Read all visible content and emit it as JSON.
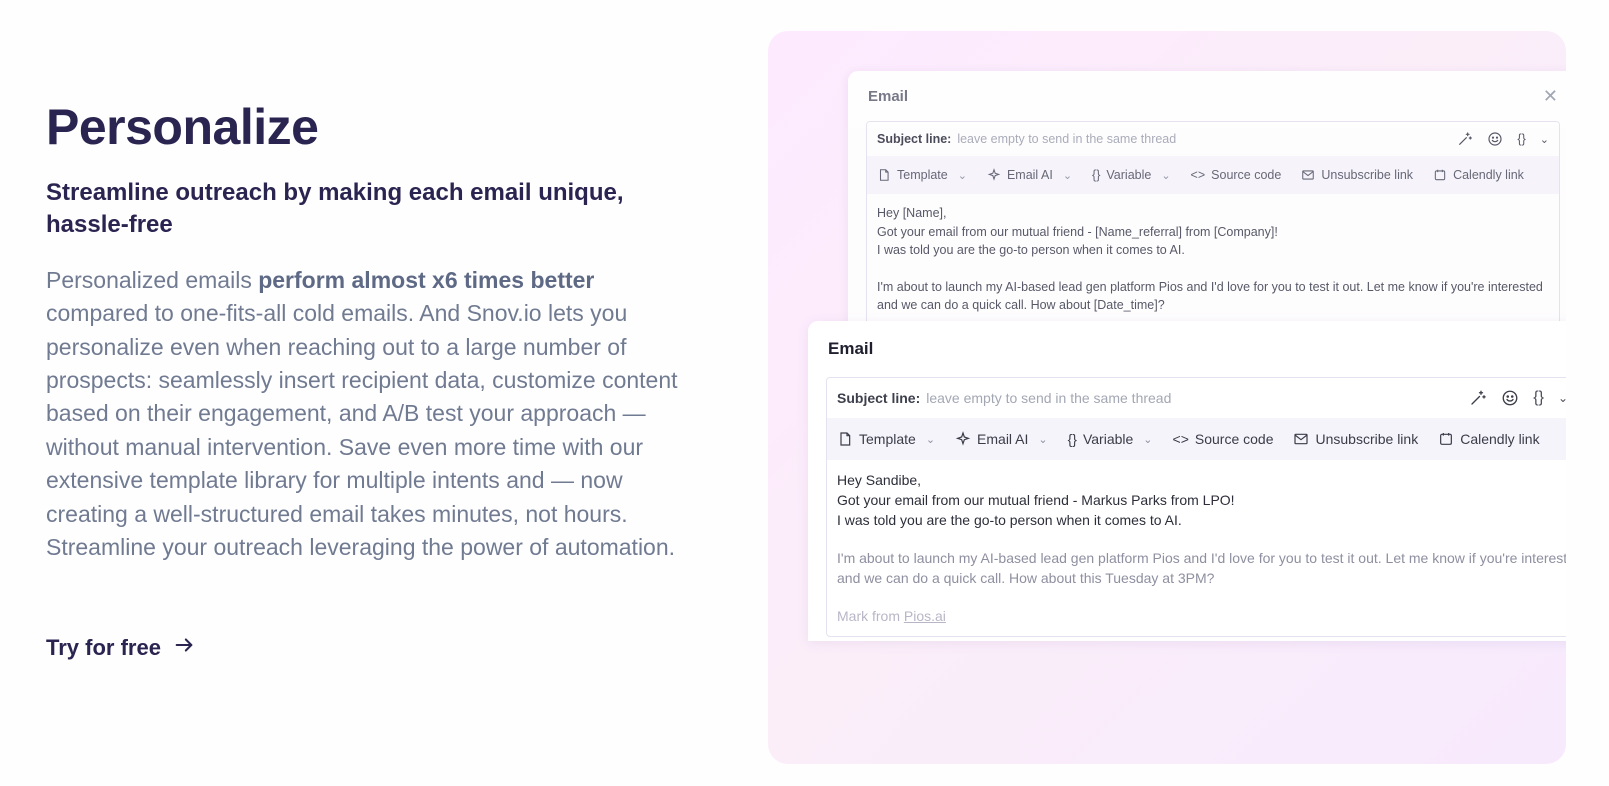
{
  "left": {
    "title": "Personalize",
    "subtitle": "Streamline outreach by making each email unique, hassle-free",
    "body_before": "Personalized emails ",
    "body_bold": "perform almost x6 times better",
    "body_after": " compared to one-fits-all cold emails. And Snov.io lets you personalize even when reaching out to a large number of prospects: seamlessly insert recipient data, customize content based on their engagement, and A/B test your approach — without manual intervention. Save even more time with our extensive template library for multiple intents and — now creating a well-structured email takes minutes, not hours. Streamline your outreach leveraging the power of automation.",
    "cta_label": "Try for free"
  },
  "panel": {
    "colors": {
      "background": "#fdeaff",
      "accent": "#2a2450"
    },
    "back_card": {
      "title": "Email",
      "subject_label": "Subject line:",
      "subject_placeholder": "leave empty to send in the same thread",
      "toolbar": {
        "template": "Template",
        "email_ai": "Email AI",
        "variable": "Variable",
        "source_code": "Source code",
        "unsubscribe": "Unsubscribe link",
        "calendly": "Calendly link"
      },
      "body": {
        "line1": "Hey [Name],",
        "line2": "Got your email from our mutual friend - [Name_referral] from [Company]!",
        "line3": "I was told you are the go-to person when it comes to AI.",
        "line4": "I'm about to launch my AI-based lead gen platform Pios and I'd love for you to test it out. Let me know if you're interested",
        "line5": "and we can do a quick call. How about [Date_time]?"
      }
    },
    "front_card": {
      "title": "Email",
      "subject_label": "Subject line:",
      "subject_placeholder": "leave empty to send in the same thread",
      "toolbar": {
        "template": "Template",
        "email_ai": "Email AI",
        "variable": "Variable",
        "source_code": "Source code",
        "unsubscribe": "Unsubscribe link",
        "calendly": "Calendly link"
      },
      "body": {
        "line1": "Hey Sandibe,",
        "line2": "Got your email from our mutual friend - Markus Parks from LPO!",
        "line3": "I was told you are the go-to person when it comes to AI.",
        "line4": "I'm about to launch my AI-based lead gen platform Pios and I'd love for you to test it out. Let me know if you're interested",
        "line5": "and we can do a quick call. How about this Tuesday at 3PM?",
        "signature_prefix": "Mark from ",
        "signature_link": "Pios.ai"
      }
    },
    "icons": [
      "magic-wand-icon",
      "smile-icon",
      "braces-icon",
      "chevron-down-icon",
      "close-icon",
      "template-icon",
      "sparkle-icon",
      "code-icon",
      "mail-x-icon",
      "calendar-icon",
      "arrow-right-icon"
    ]
  }
}
